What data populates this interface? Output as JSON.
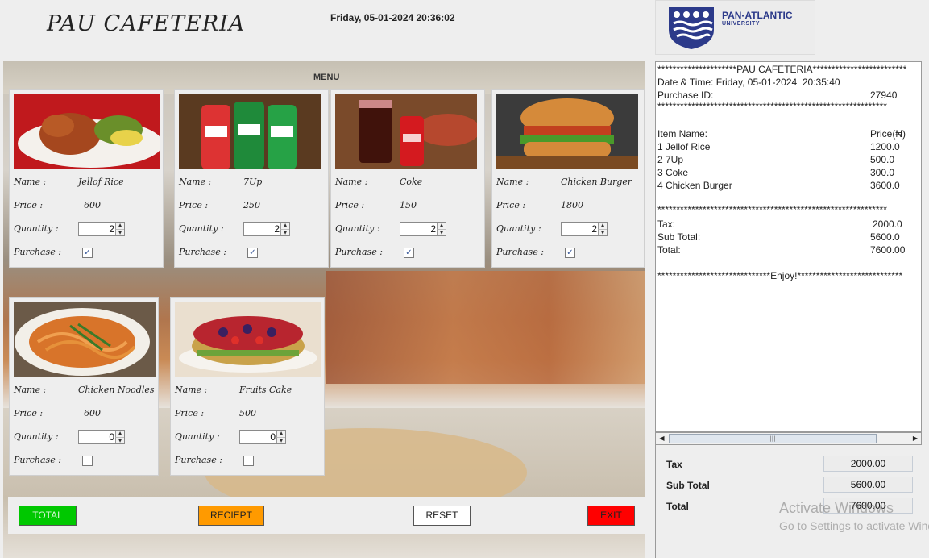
{
  "header": {
    "app_title": "PAU CAFETERIA",
    "datetime": "Friday, 05-01-2024  20:36:02"
  },
  "logo": {
    "name": "PAN-ATLANTIC",
    "sub": "UNIVERSITY"
  },
  "menu": {
    "label": "MENU",
    "field_labels": {
      "name": "Name :",
      "price": "Price :",
      "quantity": "Quantity :",
      "purchase": "Purchase :"
    },
    "items": [
      {
        "name": "Jellof Rice",
        "price": "600",
        "quantity": "2",
        "purchased": true,
        "check_glyph": "✓",
        "photo": "jollof-rice-photo"
      },
      {
        "name": "7Up",
        "price": "250",
        "quantity": "2",
        "purchased": true,
        "check_glyph": "✓",
        "photo": "7up-cans-photo"
      },
      {
        "name": "Coke",
        "price": "150",
        "quantity": "2",
        "purchased": true,
        "check_glyph": "✓",
        "photo": "coke-glass-photo"
      },
      {
        "name": "Chicken Burger",
        "price": "1800",
        "quantity": "2",
        "purchased": true,
        "check_glyph": "✓",
        "photo": "chicken-burger-photo"
      },
      {
        "name": "Chicken Noodles",
        "price": "600",
        "quantity": "0",
        "purchased": false,
        "check_glyph": "",
        "photo": "chicken-noodles-photo"
      },
      {
        "name": "Fruits Cake",
        "price": "500",
        "quantity": "0",
        "purchased": false,
        "check_glyph": "",
        "photo": "fruits-cake-photo"
      }
    ]
  },
  "buttons": {
    "total": "TOTAL",
    "receipt": "RECIEPT",
    "reset": "RESET",
    "exit": "EXIT",
    "colors": {
      "total": "#00c800",
      "receipt": "#ff9a00",
      "reset": "#ffffff",
      "exit": "#ff0000"
    }
  },
  "receipt": {
    "header_line": "*********************PAU CAFETERIA*************************",
    "datetime_line": "Date & Time: Friday, 05-01-2024  20:35:40",
    "purchase_id_label": "Purchase ID:",
    "purchase_id": "27940",
    "divider": "*************************************************************",
    "item_header": "Item Name:",
    "price_header": "Price(₦)",
    "items": [
      {
        "name": "1 Jellof Rice",
        "price": "1200.0"
      },
      {
        "name": "2 7Up",
        "price": "500.0"
      },
      {
        "name": "3 Coke",
        "price": "300.0"
      },
      {
        "name": "4 Chicken Burger",
        "price": "3600.0"
      }
    ],
    "tax_label": "Tax:",
    "tax": "2000.0",
    "subtotal_label": "Sub Total:",
    "subtotal": "5600.0",
    "total_label": "Total:",
    "total": "7600.00",
    "footer_line": "******************************Enjoy!****************************"
  },
  "totals": {
    "tax_label": "Tax",
    "tax": "2000.00",
    "subtotal_label": "Sub Total",
    "subtotal": "5600.00",
    "total_label": "Total",
    "total": "7600.00"
  },
  "watermark": {
    "line1": "Activate Windows",
    "line2": "Go to Settings to activate Windows."
  },
  "scrollbar": {
    "left_arrow": "◀",
    "right_arrow": "▶",
    "grip": "|||"
  },
  "spinner_arrows": {
    "up": "▲",
    "down": "▼"
  }
}
